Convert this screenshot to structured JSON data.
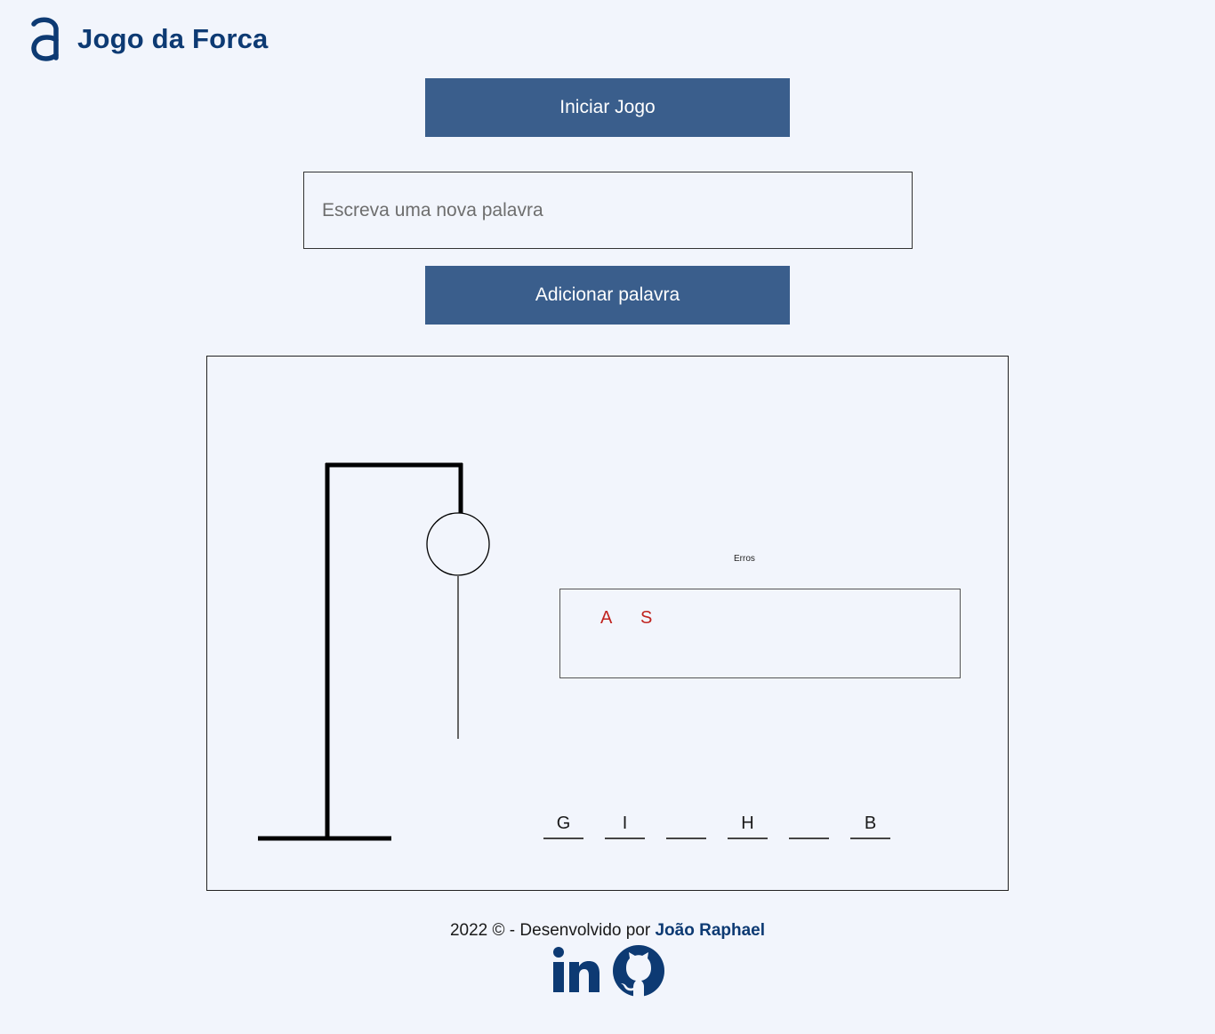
{
  "header": {
    "logo_icon": "stylized-a-logo",
    "title": "Jogo da Forca"
  },
  "controls": {
    "start_label": "Iniciar Jogo",
    "new_word_placeholder": "Escreva uma nova palavra",
    "new_word_value": "",
    "add_label": "Adicionar palavra"
  },
  "game": {
    "errors_label": "Erros",
    "wrong_letters": [
      "A",
      "S"
    ],
    "word_slots": [
      "G",
      "I",
      "",
      "H",
      "",
      "B"
    ],
    "hangman_parts_drawn": [
      "head",
      "body"
    ]
  },
  "footer": {
    "prefix": "2022 © - Desenvolvido por ",
    "author": "João Raphael",
    "social_icons": [
      "linkedin-icon",
      "github-icon"
    ]
  },
  "colors": {
    "background": "#f2f5fc",
    "brand": "#0d3a73",
    "button": "#3a5e8c",
    "wrong_letter": "#c0231f"
  }
}
